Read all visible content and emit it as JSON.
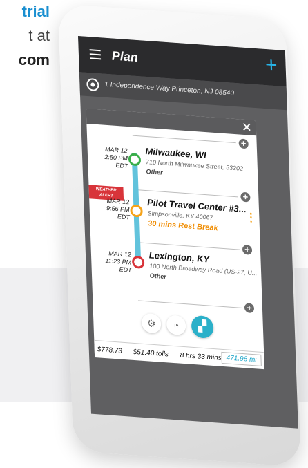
{
  "promo": {
    "line1": "trial",
    "line2": "t at",
    "line3": "com"
  },
  "app": {
    "title": "Plan",
    "address": "1 Independence Way Princeton, NJ 08540"
  },
  "stops": [
    {
      "date": "MAR 12",
      "time": "2:50 PM",
      "tz": "EDT",
      "name": "Milwaukee, WI",
      "address": "710 North Milwaukee Street, 53202",
      "type": "Other"
    },
    {
      "date": "MAR 12",
      "time": "9:56 PM",
      "tz": "EDT",
      "name": "Pilot Travel Center #3...",
      "address": "Simpsonville, KY 40067",
      "rest": "30 mins Rest Break"
    },
    {
      "date": "MAR 12",
      "time": "11:23 PM",
      "tz": "EDT",
      "name": "Lexington, KY",
      "address": "100 North Broadway Road  (US-27, U...",
      "type": "Other"
    }
  ],
  "weather_alert": {
    "line1": "WEATHER",
    "line2": "ALERT"
  },
  "summary": {
    "cost": "$778.73",
    "tolls": "$51.40 tolls",
    "duration": "8 hrs 33 mins",
    "distance": "471.96 mi"
  },
  "icons": {
    "menu": "menu-icon",
    "add": "plus-icon",
    "location": "target-icon",
    "close": "close-icon",
    "settings": "gear-icon",
    "history": "clock-icon",
    "map": "map-icon",
    "more": "kebab-icon"
  },
  "colors": {
    "accent": "#27b4e8",
    "route": "#62c3dc",
    "start": "#3aae49",
    "rest": "#f5a31a",
    "end": "#d8343a"
  }
}
